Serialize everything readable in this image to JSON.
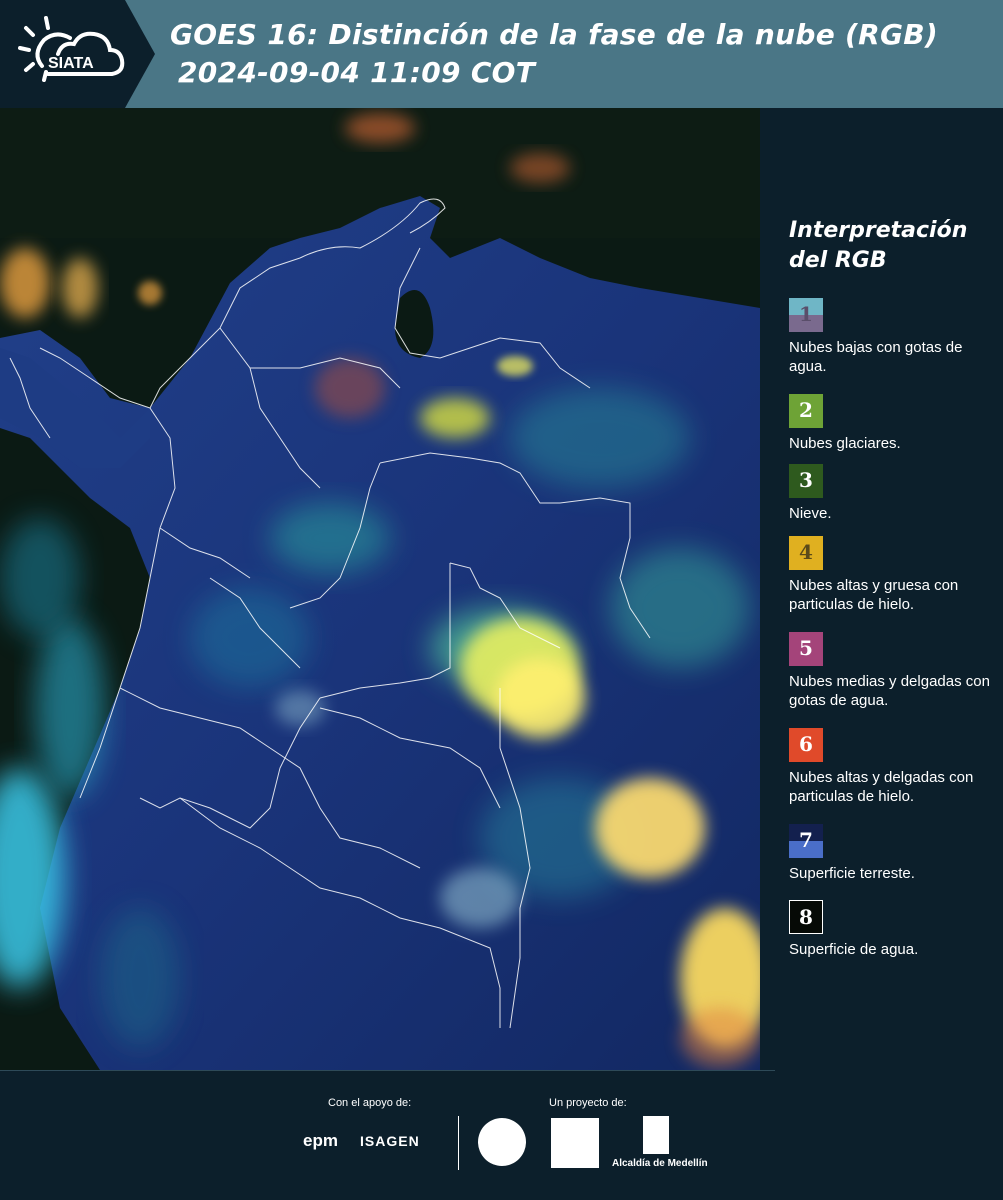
{
  "header": {
    "logo_text": "SIATA",
    "title_line1": "GOES 16: Distinción de la fase de la nube (RGB)",
    "title_line2": "2024-09-04 11:09 COT"
  },
  "legend": {
    "title": "Interpretación del RGB",
    "items": [
      {
        "num": "1",
        "label": "Nubes bajas con gotas de agua.",
        "color_top": "#6fb6c6",
        "color_bottom": "#7a6a8e",
        "text_color": "#5a4e6a"
      },
      {
        "num": "2",
        "label": "Nubes glaciares.",
        "color": "#6ea336",
        "text_color": "#ffffff"
      },
      {
        "num": "3",
        "label": "Nieve.",
        "color": "#2e5a1e",
        "text_color": "#ffffff"
      },
      {
        "num": "4",
        "label": "Nubes altas y gruesa con particulas de hielo.",
        "color": "#e0b020",
        "text_color": "#5a4a1a"
      },
      {
        "num": "5",
        "label": "Nubes medias y delgadas con gotas de agua.",
        "color": "#a4447a",
        "text_color": "#ffffff"
      },
      {
        "num": "6",
        "label": "Nubes altas y delgadas con particulas de hielo.",
        "color": "#e04a2a",
        "text_color": "#ffffff"
      },
      {
        "num": "7",
        "label": "Superficie terreste.",
        "color_top": "#13204e",
        "color_bottom": "#4a6ec8",
        "text_color": "#ffffff"
      },
      {
        "num": "8",
        "label": "Superficie de agua.",
        "color": "#060a06",
        "text_color": "#ffffff"
      }
    ]
  },
  "footer": {
    "support_label": "Con el apoyo de:",
    "project_label": "Un proyecto de:",
    "sponsor1": "epm",
    "sponsor2": "ISAGEN",
    "partner_alcaldia": "Alcaldía de Medellín"
  },
  "colors": {
    "header_bg": "#4a7686",
    "panel_bg": "#0c1f2b",
    "land": "#1a3a8a",
    "ocean": "#0a1a12"
  }
}
